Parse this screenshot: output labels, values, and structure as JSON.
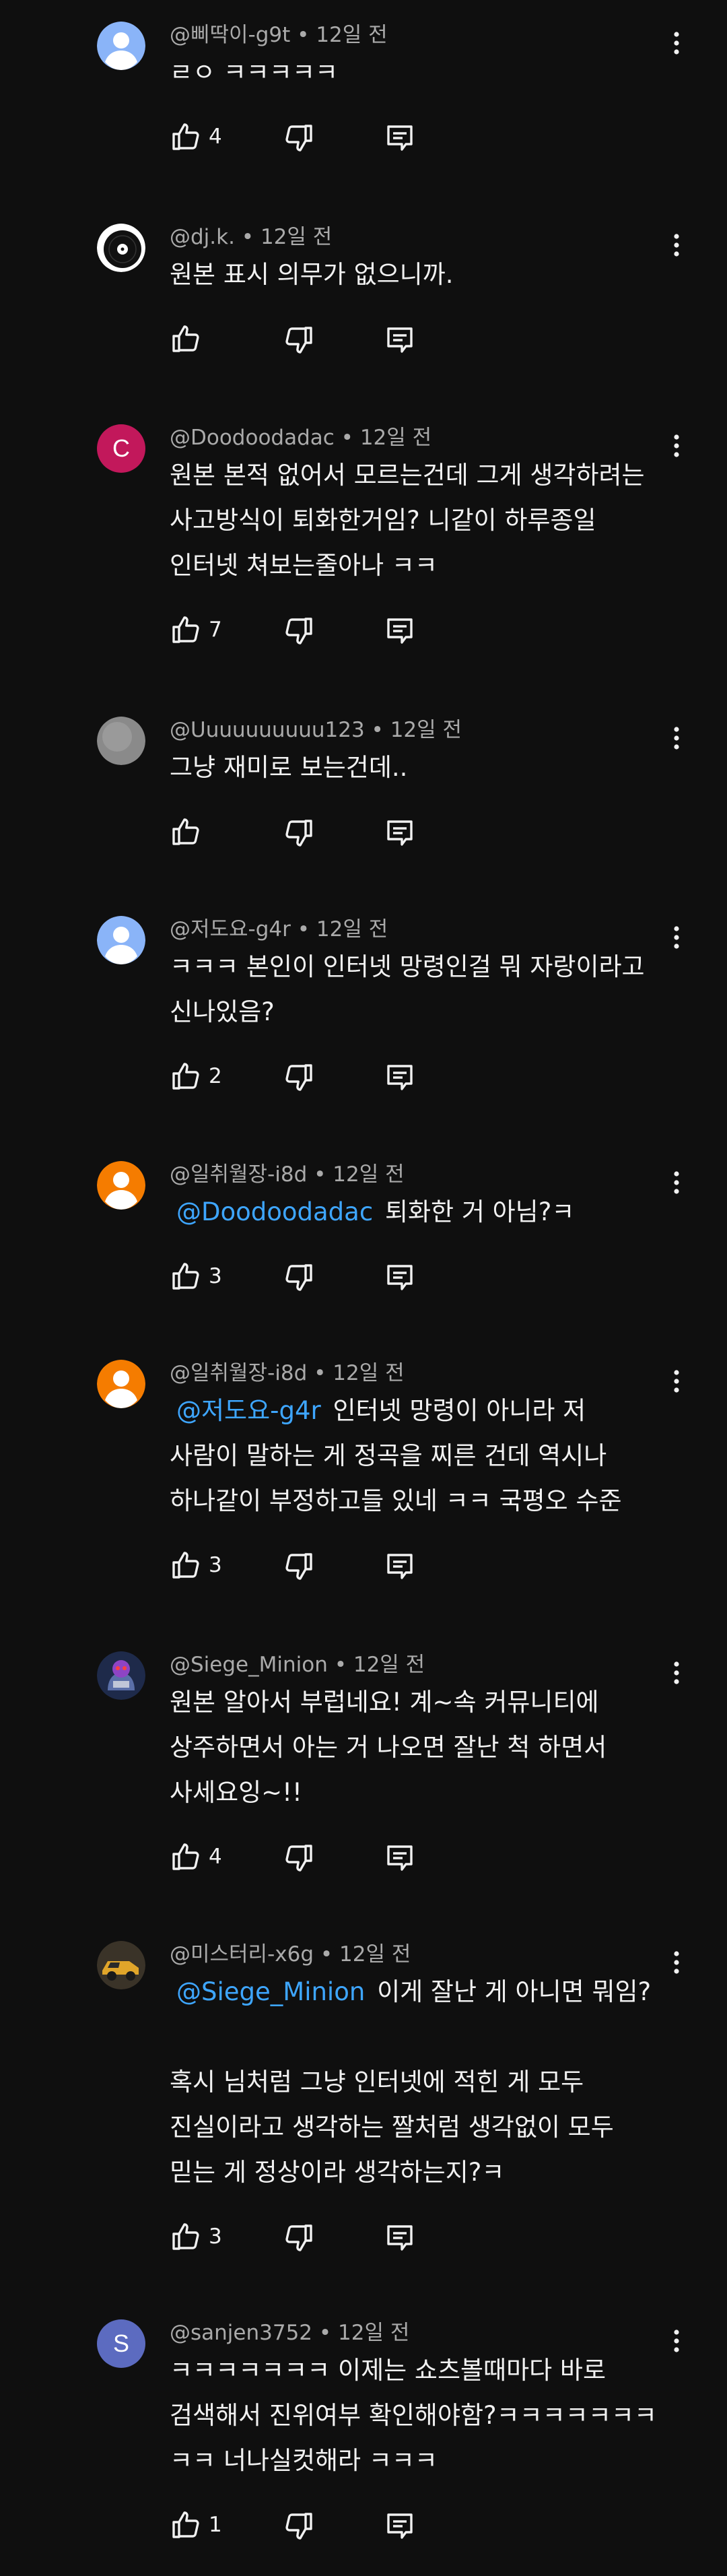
{
  "comments": [
    {
      "author": "@삐딱이-g9t",
      "time": "12일 전",
      "avatar": {
        "kind": "person",
        "bg": "#8ab4f8"
      },
      "lines": [
        [
          {
            "t": "ㄹㅇ ㅋㅋㅋㅋㅋ"
          }
        ]
      ],
      "likes": "4"
    },
    {
      "author": "@dj.k.",
      "time": "12일 전",
      "avatar": {
        "kind": "vinyl"
      },
      "lines": [
        [
          {
            "t": "원본 표시 의무가 없으니까."
          }
        ]
      ],
      "likes": ""
    },
    {
      "author": "@Doodoodadac",
      "time": "12일 전",
      "avatar": {
        "kind": "letter",
        "letter": "C",
        "bg": "#c2185b"
      },
      "lines": [
        [
          {
            "t": "원본 본적 없어서 모르는건데 그게 생각하려는"
          }
        ],
        [
          {
            "t": "사고방식이 퇴화한거임? 니같이 하루종일"
          }
        ],
        [
          {
            "t": "인터넷 쳐보는줄아나 ㅋㅋ"
          }
        ]
      ],
      "likes": "7"
    },
    {
      "author": "@Uuuuuuuuuu123",
      "time": "12일 전",
      "avatar": {
        "kind": "blur"
      },
      "lines": [
        [
          {
            "t": "그냥 재미로 보는건데.."
          }
        ]
      ],
      "likes": ""
    },
    {
      "author": "@저도요-g4r",
      "time": "12일 전",
      "avatar": {
        "kind": "person",
        "bg": "#8ab4f8"
      },
      "lines": [
        [
          {
            "t": "ㅋㅋㅋ 본인이 인터넷 망령인걸 뭐 자랑이라고"
          }
        ],
        [
          {
            "t": "신나있음?"
          }
        ]
      ],
      "likes": "2"
    },
    {
      "author": "@일취월장-i8d",
      "time": "12일 전",
      "avatar": {
        "kind": "person",
        "bg": "#f57c00"
      },
      "lines": [
        [
          {
            "t": "@Doodoodadac",
            "m": true
          },
          {
            "t": " 퇴화한 거 아님?ㅋ"
          }
        ]
      ],
      "likes": "3"
    },
    {
      "author": "@일취월장-i8d",
      "time": "12일 전",
      "avatar": {
        "kind": "person",
        "bg": "#f57c00"
      },
      "lines": [
        [
          {
            "t": "@저도요-g4r",
            "m": true
          },
          {
            "t": " 인터넷 망령이 아니라 저"
          }
        ],
        [
          {
            "t": "사람이 말하는 게 정곡을 찌른 건데 역시나"
          }
        ],
        [
          {
            "t": "하나같이 부정하고들 있네 ㅋㅋ 국평오 수준"
          }
        ]
      ],
      "likes": "3"
    },
    {
      "author": "@Siege_Minion",
      "time": "12일 전",
      "avatar": {
        "kind": "minion"
      },
      "lines": [
        [
          {
            "t": "원본 알아서 부럽네요! 계~속 커뮤니티에"
          }
        ],
        [
          {
            "t": "상주하면서 아는 거 나오면 잘난 척 하면서"
          }
        ],
        [
          {
            "t": "사세요잉~!!"
          }
        ]
      ],
      "likes": "4"
    },
    {
      "author": "@미스터리-x6g",
      "time": "12일 전",
      "avatar": {
        "kind": "car"
      },
      "lines": [
        [
          {
            "t": "@Siege_Minion",
            "m": true
          },
          {
            "t": " 이게 잘난 게 아니면 뭐임?"
          }
        ],
        [],
        [
          {
            "t": "혹시 님처럼 그냥 인터넷에 적힌 게 모두"
          }
        ],
        [
          {
            "t": "진실이라고 생각하는 짤처럼 생각없이 모두"
          }
        ],
        [
          {
            "t": "믿는 게 정상이라 생각하는지?ㅋ"
          }
        ]
      ],
      "likes": "3"
    },
    {
      "author": "@sanjen3752",
      "time": "12일 전",
      "avatar": {
        "kind": "letter",
        "letter": "S",
        "bg": "#5c6bc0"
      },
      "lines": [
        [
          {
            "t": "ㅋㅋㅋㅋㅋㅋㅋ 이제는 쇼츠볼때마다 바로"
          }
        ],
        [
          {
            "t": "검색해서 진위여부 확인해야함?ㅋㅋㅋㅋㅋㅋㅋ"
          }
        ],
        [
          {
            "t": "ㅋㅋ 너나실컷해라 ㅋㅋㅋ"
          }
        ]
      ],
      "likes": "1"
    }
  ]
}
